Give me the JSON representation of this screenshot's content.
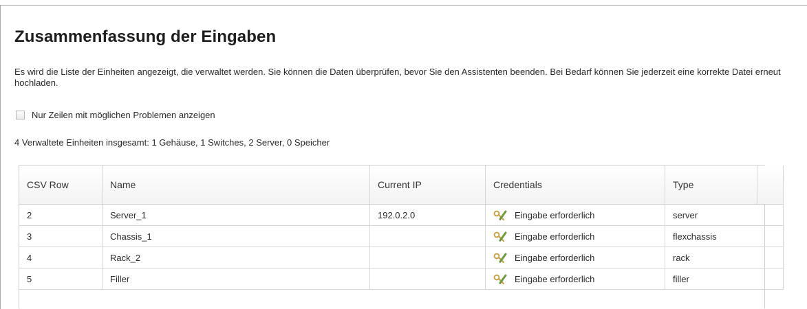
{
  "title": "Zusammenfassung der Eingaben",
  "description": "Es wird die Liste der Einheiten angezeigt, die verwaltet werden. Sie können die Daten überprüfen, bevor Sie den Assistenten beenden. Bei Bedarf können Sie jederzeit eine korrekte Datei erneut hochladen.",
  "filter": {
    "label": "Nur Zeilen mit möglichen Problemen anzeigen",
    "checked": false
  },
  "summary": "4 Verwaltete Einheiten insgesamt: 1 Gehäuse, 1 Switches, 2 Server, 0 Speicher",
  "table": {
    "headers": {
      "csv_row": "CSV Row",
      "name": "Name",
      "current_ip": "Current IP",
      "credentials": "Credentials",
      "type": "Type"
    },
    "rows": [
      {
        "csv_row": "2",
        "name": "Server_1",
        "current_ip": "192.0.2.0",
        "credentials": "Eingabe erforderlich",
        "credentials_icon": "edit-credentials-icon",
        "type": "server"
      },
      {
        "csv_row": "3",
        "name": "Chassis_1",
        "current_ip": "",
        "credentials": "Eingabe erforderlich",
        "credentials_icon": "edit-credentials-icon",
        "type": "flexchassis"
      },
      {
        "csv_row": "4",
        "name": "Rack_2",
        "current_ip": "",
        "credentials": "Eingabe erforderlich",
        "credentials_icon": "edit-credentials-icon",
        "type": "rack"
      },
      {
        "csv_row": "5",
        "name": "Filler",
        "current_ip": "",
        "credentials": "Eingabe erforderlich",
        "credentials_icon": "edit-credentials-icon",
        "type": "filler"
      }
    ]
  },
  "colors": {
    "icon_key": "#c9a14a",
    "icon_pencil": "#6f9d3c",
    "border": "#cfcfcf"
  }
}
